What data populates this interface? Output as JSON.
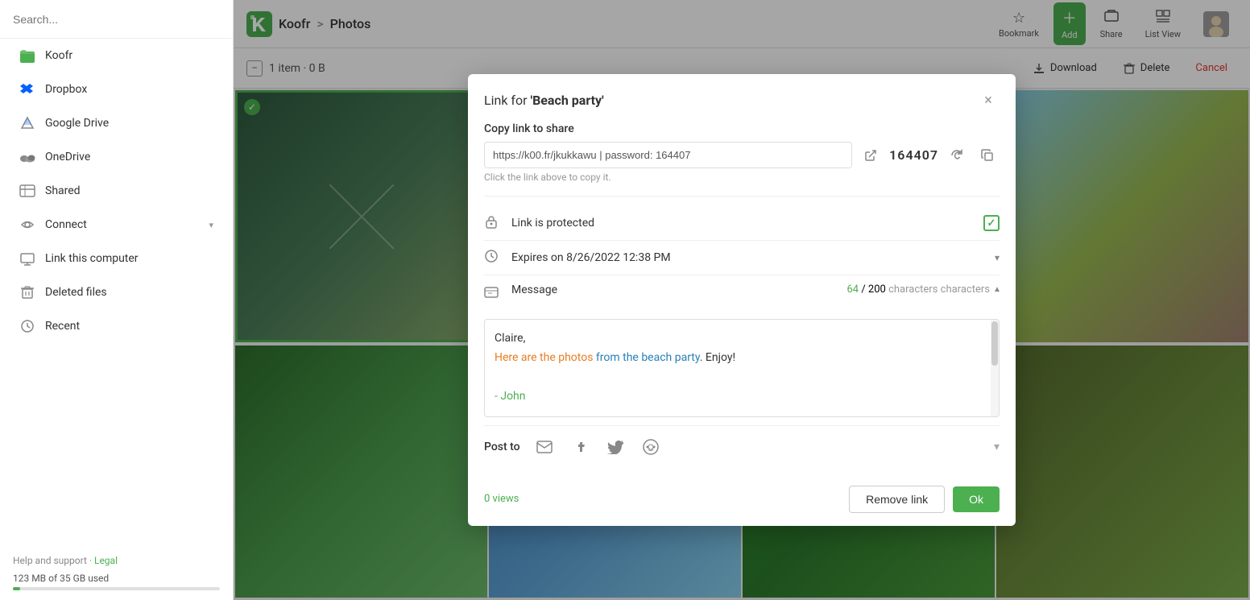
{
  "app": {
    "logo_text": "Koofr",
    "breadcrumb_separator": ">",
    "breadcrumb_page": "Photos"
  },
  "topbar": {
    "bookmark_label": "Bookmark",
    "add_label": "Add",
    "share_label": "Share",
    "listview_label": "List View"
  },
  "actionbar": {
    "item_count": "1 item · 0 B",
    "download_label": "Download",
    "delete_label": "Delete",
    "cancel_label": "Cancel"
  },
  "sidebar": {
    "search_placeholder": "Search...",
    "items": [
      {
        "id": "koofr",
        "label": "Koofr",
        "icon": "folder"
      },
      {
        "id": "dropbox",
        "label": "Dropbox",
        "icon": "dropbox"
      },
      {
        "id": "google-drive",
        "label": "Google Drive",
        "icon": "drive"
      },
      {
        "id": "onedrive",
        "label": "OneDrive",
        "icon": "onedrive"
      },
      {
        "id": "shared",
        "label": "Shared",
        "icon": "shared"
      },
      {
        "id": "connect",
        "label": "Connect",
        "icon": "connect"
      },
      {
        "id": "link-computer",
        "label": "Link this computer",
        "icon": "computer"
      },
      {
        "id": "deleted",
        "label": "Deleted files",
        "icon": "trash"
      },
      {
        "id": "recent",
        "label": "Recent",
        "icon": "recent"
      }
    ],
    "footer": {
      "help": "Help and support",
      "separator": "·",
      "legal": "Legal"
    },
    "storage": {
      "text": "123 MB of 35 GB used"
    }
  },
  "modal": {
    "title_prefix": "Link for ",
    "title_name": "'Beach party'",
    "close_aria": "Close",
    "copy_section": {
      "label": "Copy link to share",
      "url": "https://k00.fr/jkukkawu | password: 164407",
      "hint": "Click the link above to copy it."
    },
    "password": {
      "value": "164407"
    },
    "link_protected": {
      "label": "Link is protected",
      "checked": true
    },
    "expires": {
      "label": "Expires on 8/26/2022 12:38 PM"
    },
    "message": {
      "label": "Message",
      "used_chars": "64",
      "total_chars": "200",
      "chars_label": "characters",
      "content_line1": "Claire,",
      "content_line2_orange": "Here are the photos ",
      "content_line2_blue": "from the beach party",
      "content_line2_black": ". Enjoy!",
      "content_line3": "",
      "content_line4_green": "- John"
    },
    "post_to": {
      "label": "Post to"
    },
    "views": {
      "count": "0",
      "label": "views"
    },
    "buttons": {
      "remove_link": "Remove link",
      "ok": "Ok"
    }
  }
}
